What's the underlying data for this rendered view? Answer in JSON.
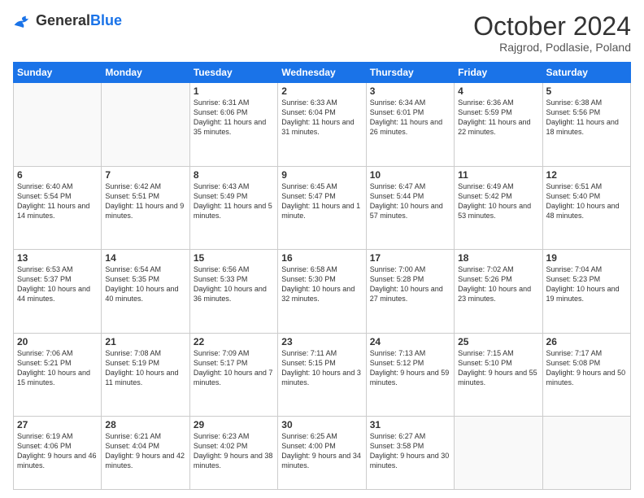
{
  "header": {
    "logo_general": "General",
    "logo_blue": "Blue",
    "month": "October 2024",
    "location": "Rajgrod, Podlasie, Poland"
  },
  "weekdays": [
    "Sunday",
    "Monday",
    "Tuesday",
    "Wednesday",
    "Thursday",
    "Friday",
    "Saturday"
  ],
  "weeks": [
    [
      {
        "day": "",
        "sunrise": "",
        "sunset": "",
        "daylight": ""
      },
      {
        "day": "",
        "sunrise": "",
        "sunset": "",
        "daylight": ""
      },
      {
        "day": "1",
        "sunrise": "Sunrise: 6:31 AM",
        "sunset": "Sunset: 6:06 PM",
        "daylight": "Daylight: 11 hours and 35 minutes."
      },
      {
        "day": "2",
        "sunrise": "Sunrise: 6:33 AM",
        "sunset": "Sunset: 6:04 PM",
        "daylight": "Daylight: 11 hours and 31 minutes."
      },
      {
        "day": "3",
        "sunrise": "Sunrise: 6:34 AM",
        "sunset": "Sunset: 6:01 PM",
        "daylight": "Daylight: 11 hours and 26 minutes."
      },
      {
        "day": "4",
        "sunrise": "Sunrise: 6:36 AM",
        "sunset": "Sunset: 5:59 PM",
        "daylight": "Daylight: 11 hours and 22 minutes."
      },
      {
        "day": "5",
        "sunrise": "Sunrise: 6:38 AM",
        "sunset": "Sunset: 5:56 PM",
        "daylight": "Daylight: 11 hours and 18 minutes."
      }
    ],
    [
      {
        "day": "6",
        "sunrise": "Sunrise: 6:40 AM",
        "sunset": "Sunset: 5:54 PM",
        "daylight": "Daylight: 11 hours and 14 minutes."
      },
      {
        "day": "7",
        "sunrise": "Sunrise: 6:42 AM",
        "sunset": "Sunset: 5:51 PM",
        "daylight": "Daylight: 11 hours and 9 minutes."
      },
      {
        "day": "8",
        "sunrise": "Sunrise: 6:43 AM",
        "sunset": "Sunset: 5:49 PM",
        "daylight": "Daylight: 11 hours and 5 minutes."
      },
      {
        "day": "9",
        "sunrise": "Sunrise: 6:45 AM",
        "sunset": "Sunset: 5:47 PM",
        "daylight": "Daylight: 11 hours and 1 minute."
      },
      {
        "day": "10",
        "sunrise": "Sunrise: 6:47 AM",
        "sunset": "Sunset: 5:44 PM",
        "daylight": "Daylight: 10 hours and 57 minutes."
      },
      {
        "day": "11",
        "sunrise": "Sunrise: 6:49 AM",
        "sunset": "Sunset: 5:42 PM",
        "daylight": "Daylight: 10 hours and 53 minutes."
      },
      {
        "day": "12",
        "sunrise": "Sunrise: 6:51 AM",
        "sunset": "Sunset: 5:40 PM",
        "daylight": "Daylight: 10 hours and 48 minutes."
      }
    ],
    [
      {
        "day": "13",
        "sunrise": "Sunrise: 6:53 AM",
        "sunset": "Sunset: 5:37 PM",
        "daylight": "Daylight: 10 hours and 44 minutes."
      },
      {
        "day": "14",
        "sunrise": "Sunrise: 6:54 AM",
        "sunset": "Sunset: 5:35 PM",
        "daylight": "Daylight: 10 hours and 40 minutes."
      },
      {
        "day": "15",
        "sunrise": "Sunrise: 6:56 AM",
        "sunset": "Sunset: 5:33 PM",
        "daylight": "Daylight: 10 hours and 36 minutes."
      },
      {
        "day": "16",
        "sunrise": "Sunrise: 6:58 AM",
        "sunset": "Sunset: 5:30 PM",
        "daylight": "Daylight: 10 hours and 32 minutes."
      },
      {
        "day": "17",
        "sunrise": "Sunrise: 7:00 AM",
        "sunset": "Sunset: 5:28 PM",
        "daylight": "Daylight: 10 hours and 27 minutes."
      },
      {
        "day": "18",
        "sunrise": "Sunrise: 7:02 AM",
        "sunset": "Sunset: 5:26 PM",
        "daylight": "Daylight: 10 hours and 23 minutes."
      },
      {
        "day": "19",
        "sunrise": "Sunrise: 7:04 AM",
        "sunset": "Sunset: 5:23 PM",
        "daylight": "Daylight: 10 hours and 19 minutes."
      }
    ],
    [
      {
        "day": "20",
        "sunrise": "Sunrise: 7:06 AM",
        "sunset": "Sunset: 5:21 PM",
        "daylight": "Daylight: 10 hours and 15 minutes."
      },
      {
        "day": "21",
        "sunrise": "Sunrise: 7:08 AM",
        "sunset": "Sunset: 5:19 PM",
        "daylight": "Daylight: 10 hours and 11 minutes."
      },
      {
        "day": "22",
        "sunrise": "Sunrise: 7:09 AM",
        "sunset": "Sunset: 5:17 PM",
        "daylight": "Daylight: 10 hours and 7 minutes."
      },
      {
        "day": "23",
        "sunrise": "Sunrise: 7:11 AM",
        "sunset": "Sunset: 5:15 PM",
        "daylight": "Daylight: 10 hours and 3 minutes."
      },
      {
        "day": "24",
        "sunrise": "Sunrise: 7:13 AM",
        "sunset": "Sunset: 5:12 PM",
        "daylight": "Daylight: 9 hours and 59 minutes."
      },
      {
        "day": "25",
        "sunrise": "Sunrise: 7:15 AM",
        "sunset": "Sunset: 5:10 PM",
        "daylight": "Daylight: 9 hours and 55 minutes."
      },
      {
        "day": "26",
        "sunrise": "Sunrise: 7:17 AM",
        "sunset": "Sunset: 5:08 PM",
        "daylight": "Daylight: 9 hours and 50 minutes."
      }
    ],
    [
      {
        "day": "27",
        "sunrise": "Sunrise: 6:19 AM",
        "sunset": "Sunset: 4:06 PM",
        "daylight": "Daylight: 9 hours and 46 minutes."
      },
      {
        "day": "28",
        "sunrise": "Sunrise: 6:21 AM",
        "sunset": "Sunset: 4:04 PM",
        "daylight": "Daylight: 9 hours and 42 minutes."
      },
      {
        "day": "29",
        "sunrise": "Sunrise: 6:23 AM",
        "sunset": "Sunset: 4:02 PM",
        "daylight": "Daylight: 9 hours and 38 minutes."
      },
      {
        "day": "30",
        "sunrise": "Sunrise: 6:25 AM",
        "sunset": "Sunset: 4:00 PM",
        "daylight": "Daylight: 9 hours and 34 minutes."
      },
      {
        "day": "31",
        "sunrise": "Sunrise: 6:27 AM",
        "sunset": "Sunset: 3:58 PM",
        "daylight": "Daylight: 9 hours and 30 minutes."
      },
      {
        "day": "",
        "sunrise": "",
        "sunset": "",
        "daylight": ""
      },
      {
        "day": "",
        "sunrise": "",
        "sunset": "",
        "daylight": ""
      }
    ]
  ]
}
